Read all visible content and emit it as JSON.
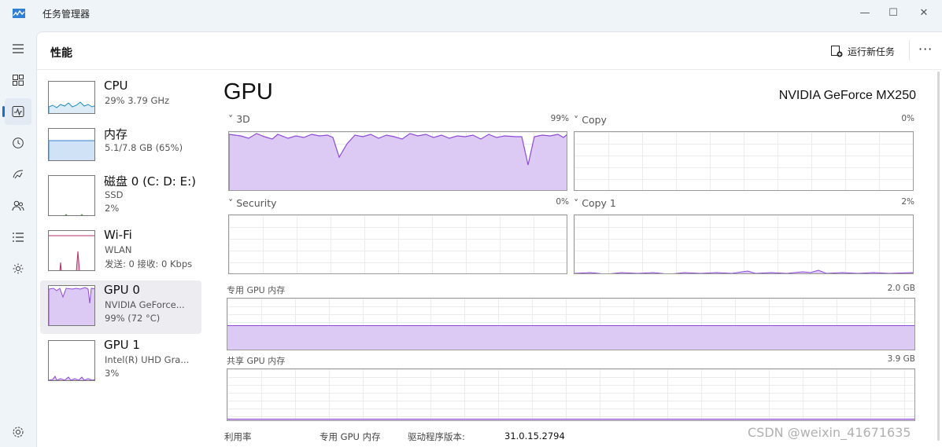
{
  "window": {
    "title": "任务管理器",
    "minimize_icon": "minimize-icon",
    "maximize_icon": "maximize-icon",
    "close_icon": "close-icon"
  },
  "nav": {
    "items": [
      "menu-icon",
      "processes-icon",
      "performance-icon",
      "history-icon",
      "startup-icon",
      "users-icon",
      "details-icon",
      "services-icon",
      "settings-icon"
    ],
    "active": "performance-icon"
  },
  "header": {
    "title": "性能",
    "run_task": "运行新任务",
    "more": "···"
  },
  "devices": [
    {
      "name": "CPU",
      "line1": "29% 3.79 GHz",
      "line2": "",
      "color": "#1c8ac0"
    },
    {
      "name": "内存",
      "line1": "5.1/7.8 GB (65%)",
      "line2": "",
      "color": "#3a7fd0"
    },
    {
      "name": "磁盘 0 (C: D: E:)",
      "line1": "SSD",
      "line2": "2%",
      "color": "#4f9b3a"
    },
    {
      "name": "Wi-Fi",
      "line1": "WLAN",
      "line2": "发送: 0 接收: 0 Kbps",
      "color": "#b0306e"
    },
    {
      "name": "GPU 0",
      "line1": "NVIDIA GeForce...",
      "line2": "99% (72 °C)",
      "color": "#8f4ad8"
    },
    {
      "name": "GPU 1",
      "line1": "Intel(R) UHD Gra...",
      "line2": "3%",
      "color": "#8f4ad8"
    }
  ],
  "main": {
    "title": "GPU",
    "model": "NVIDIA GeForce MX250",
    "engines": [
      {
        "label": "3D",
        "pct": "99%"
      },
      {
        "label": "Copy",
        "pct": "0%"
      },
      {
        "label": "Security",
        "pct": "0%"
      },
      {
        "label": "Copy 1",
        "pct": "2%"
      }
    ],
    "dedicated": {
      "label": "专用 GPU 内存",
      "value": "2.0 GB",
      "fill_percent": 48
    },
    "shared": {
      "label": "共享 GPU 内存",
      "value": "3.9 GB",
      "fill_percent": 3
    },
    "footer": {
      "util": "利用率",
      "dedicated": "专用 GPU 内存",
      "driver_label": "驱动程序版本:",
      "driver_value": "31.0.15.2794"
    }
  },
  "watermark": "CSDN @weixin_41671635"
}
